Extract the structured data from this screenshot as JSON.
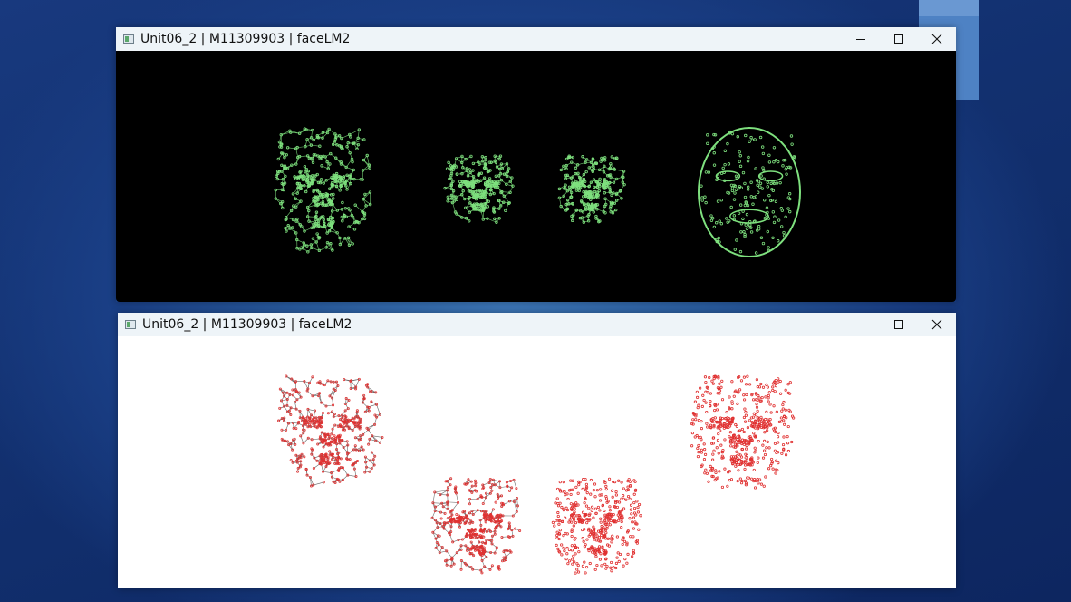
{
  "windows": [
    {
      "title": "Unit06_2 | M11309903 | faceLM2",
      "background": "#000000",
      "mesh_color": "#7ee07e",
      "faces": [
        "face-mesh-large",
        "face-mesh-small",
        "face-mesh-tilted",
        "face-contour-mask"
      ]
    },
    {
      "title": "Unit06_2 | M11309903 | faceLM2",
      "background": "#ffffff",
      "mesh_color": "#e03030",
      "faces": [
        "face-3d-mesh-rotated",
        "face-3d-mesh-front",
        "face-3d-points-left",
        "face-3d-points-right"
      ]
    }
  ],
  "controls": {
    "minimize": "minimize-icon",
    "maximize": "maximize-icon",
    "close": "close-icon"
  }
}
